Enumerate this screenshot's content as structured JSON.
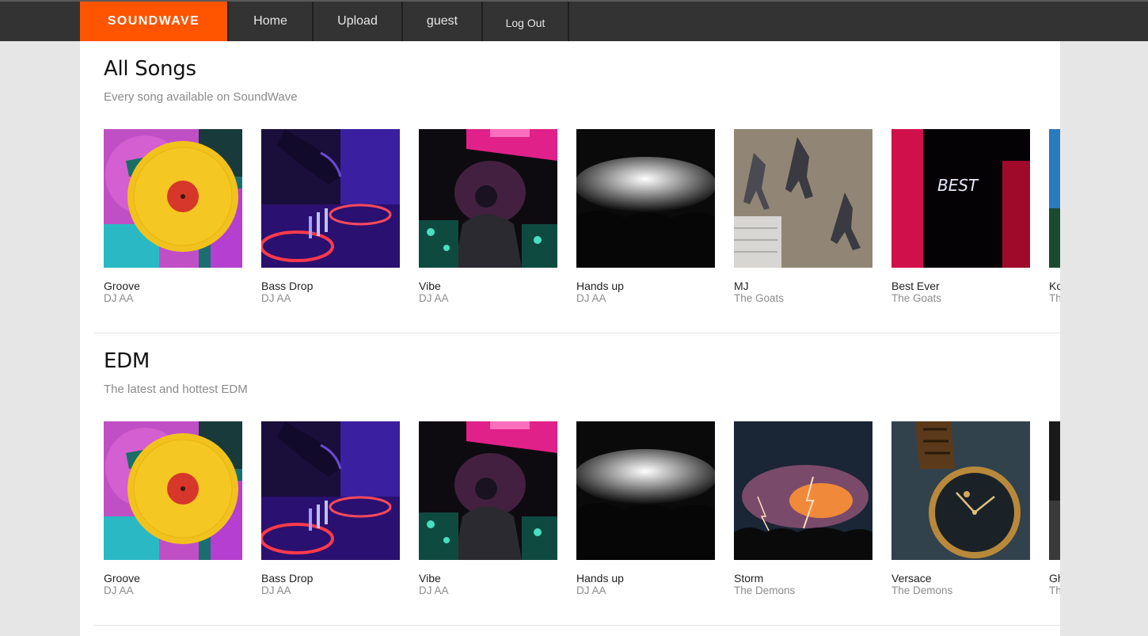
{
  "nav": {
    "brand": "SOUNDWAVE",
    "home": "Home",
    "upload": "Upload",
    "user": "guest",
    "logout": "Log Out"
  },
  "sections": [
    {
      "title": "All Songs",
      "subtitle": "Every song available on SoundWave",
      "tracks": [
        {
          "title": "Groove",
          "artist": "DJ AA"
        },
        {
          "title": "Bass Drop",
          "artist": "DJ AA"
        },
        {
          "title": "Vibe",
          "artist": "DJ AA"
        },
        {
          "title": "Hands up",
          "artist": "DJ AA"
        },
        {
          "title": "MJ",
          "artist": "The Goats"
        },
        {
          "title": "Best Ever",
          "artist": "The Goats"
        },
        {
          "title": "Ko",
          "artist": "Th"
        }
      ]
    },
    {
      "title": "EDM",
      "subtitle": "The latest and hottest EDM",
      "tracks": [
        {
          "title": "Groove",
          "artist": "DJ AA"
        },
        {
          "title": "Bass Drop",
          "artist": "DJ AA"
        },
        {
          "title": "Vibe",
          "artist": "DJ AA"
        },
        {
          "title": "Hands up",
          "artist": "DJ AA"
        },
        {
          "title": "Storm",
          "artist": "The Demons"
        },
        {
          "title": "Versace",
          "artist": "The Demons"
        },
        {
          "title": "Gh",
          "artist": "Th"
        }
      ]
    }
  ],
  "cover_art_text": {
    "best_ever_neon": "BEST"
  }
}
